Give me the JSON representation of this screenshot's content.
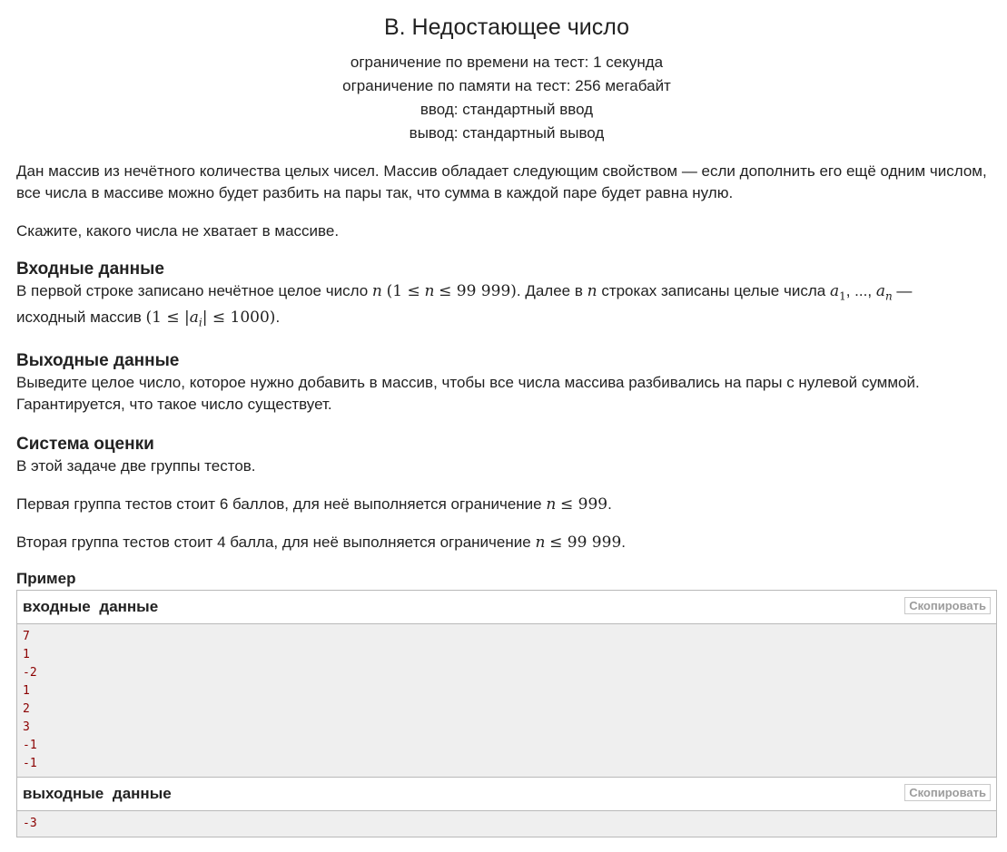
{
  "problem": {
    "title": "B. Недостающее число",
    "limits": {
      "time": "ограничение по времени на тест: 1 секунда",
      "memory": "ограничение по памяти на тест: 256 мегабайт",
      "input": "ввод: стандартный ввод",
      "output": "вывод: стандартный вывод"
    },
    "legend": {
      "p1": "Дан массив из нечётного количества целых чисел. Массив обладает следующим свойством — если дополнить его ещё одним числом, все числа в массиве можно будет разбить на пары так, что сумма в каждой паре будет равна нулю.",
      "p2": "Скажите, какого числа не хватает в массиве."
    },
    "input_section": {
      "title": "Входные данные",
      "t1": "В первой строке записано нечётное целое число",
      "var_n": "n",
      "c1": "(1 ≤",
      "c2": "≤ 99 999)",
      "t2": ". Далее в",
      "t3": "строках записаны целые числа",
      "a1": "a",
      "a1_sub": "1",
      "dots": ", ...,",
      "an": "a",
      "an_sub": "n",
      "dash": " —",
      "t4": "исходный массив",
      "c3": "(1 ≤ |",
      "ai": "a",
      "ai_sub": "i",
      "c4": "| ≤ 1000)",
      "end": "."
    },
    "output_section": {
      "title": "Выходные данные",
      "text": "Выведите целое число, которое нужно добавить в массив, чтобы все числа массива разбивались на пары с нулевой суммой. Гарантируется, что такое число существует."
    },
    "scoring": {
      "title": "Система оценки",
      "p1": "В этой задаче две группы тестов.",
      "p2_text": "Первая группа тестов стоит 6 баллов, для неё выполняется ограничение",
      "p2_var": "n",
      "p2_math": "≤ 999",
      "p3_text": "Вторая группа тестов стоит 4 балла, для неё выполняется ограничение",
      "p3_var": "n",
      "p3_math": "≤ 99 999",
      "end": "."
    },
    "example": {
      "title": "Пример",
      "input_label": "входные данные",
      "output_label": "выходные данные",
      "copy_label": "Скопировать",
      "input_lines": [
        "7",
        "1",
        "-2",
        "1",
        "2",
        "3",
        "-1",
        "-1"
      ],
      "output_lines": [
        "-3"
      ]
    }
  }
}
